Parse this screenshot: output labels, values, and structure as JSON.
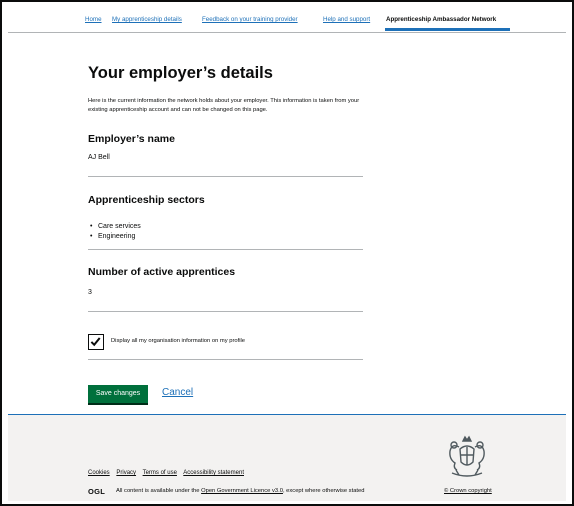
{
  "nav": {
    "items": [
      {
        "label": "Home"
      },
      {
        "label": "My apprenticeship details"
      },
      {
        "label": "Feedback on your training provider"
      },
      {
        "label": "Help and support"
      },
      {
        "label": "Apprenticeship Ambassador Network"
      }
    ]
  },
  "main": {
    "title": "Your employer’s details",
    "intro": "Here is the current information the network holds about your employer. This information is taken from your existing apprenticeship account and can not be changed on this page.",
    "employer_heading": "Employer’s name",
    "employer_name": "AJ Bell",
    "sectors_heading": "Apprenticeship sectors",
    "sectors": [
      "Care services",
      "Engineering"
    ],
    "apprentices_heading": "Number of active apprentices",
    "apprentices_count": "3",
    "checkbox_label": "Display all my organisation information on my profile",
    "checkbox_checked": true,
    "save_label": "Save changes",
    "cancel_label": "Cancel"
  },
  "footer": {
    "links": [
      "Cookies",
      "Privacy",
      "Terms of use",
      "Accessibility statement"
    ],
    "ogl_logo": "OGL",
    "licence_prefix": "All content is available under the",
    "licence_link": "Open Government Licence v3.0",
    "licence_suffix": ", except where otherwise stated",
    "copyright": "© Crown copyright"
  },
  "colors": {
    "link": "#1d70b8",
    "button": "#00703c",
    "text": "#0b0c0c",
    "footer_bg": "#f3f2f1"
  }
}
